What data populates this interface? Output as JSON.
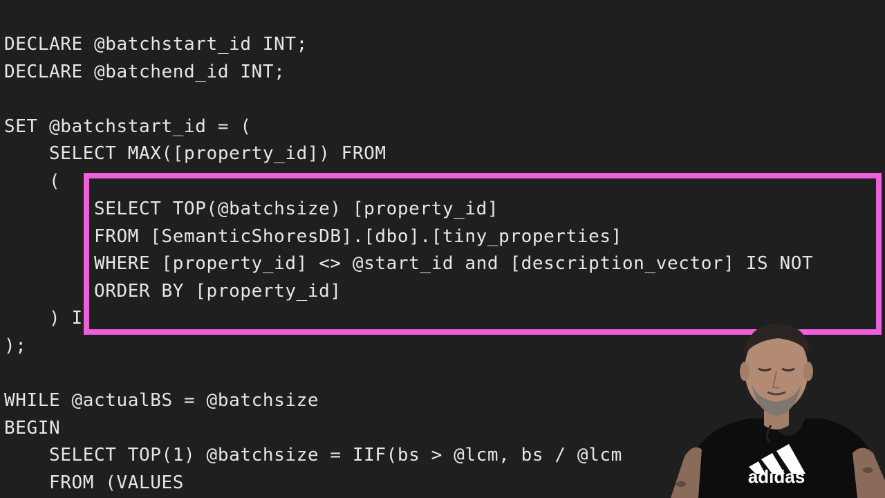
{
  "editor": {
    "lines": [
      "DECLARE @batchstart_id INT;",
      "DECLARE @batchend_id INT;",
      "",
      "SET @batchstart_id = (",
      "    SELECT MAX([property_id]) FROM",
      "    (",
      "        SELECT TOP(@batchsize) [property_id]",
      "        FROM [SemanticShoresDB].[dbo].[tiny_properties]",
      "        WHERE [property_id] <> @start_id and [description_vector] IS NOT",
      "        ORDER BY [property_id]",
      "",
      "    ) I",
      ");",
      "",
      "WHILE @actualBS = @batchsize",
      "BEGIN",
      "    SELECT TOP(1) @batchsize = IIF(bs > @lcm, bs / @lcm",
      "    FROM (VALUES"
    ]
  },
  "overlay": {
    "highlight_color": "#ee5fdc",
    "shirt_text": "adidas"
  },
  "colors": {
    "background": "#1f1f1f",
    "text": "#e6e6e6"
  }
}
